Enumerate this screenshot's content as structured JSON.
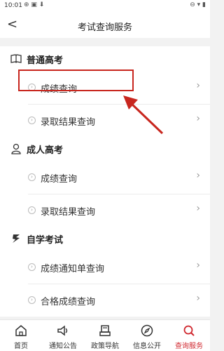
{
  "status_bar": {
    "time": "10:01"
  },
  "header": {
    "back_glyph": "<",
    "title": "考试查询服务"
  },
  "sections": [
    {
      "title": "普通高考",
      "icon": "book-icon",
      "rows": [
        "成绩查询",
        "录取结果查询"
      ]
    },
    {
      "title": "成人高考",
      "icon": "person-icon",
      "rows": [
        "成绩查询",
        "录取结果查询"
      ]
    },
    {
      "title": "自学考试",
      "icon": "self-study-icon",
      "rows": [
        "成绩通知单查询",
        "合格成绩查询"
      ]
    }
  ],
  "bottom_nav": [
    {
      "label": "首页",
      "icon": "home-icon"
    },
    {
      "label": "通知公告",
      "icon": "speaker-icon"
    },
    {
      "label": "政策导航",
      "icon": "policy-icon"
    },
    {
      "label": "信息公开",
      "icon": "compass-icon"
    },
    {
      "label": "查询服务",
      "icon": "search-icon",
      "active": true
    }
  ],
  "colors": {
    "accent": "#d0282f",
    "highlight": "#c8261e",
    "background": "#f2f2f2"
  }
}
